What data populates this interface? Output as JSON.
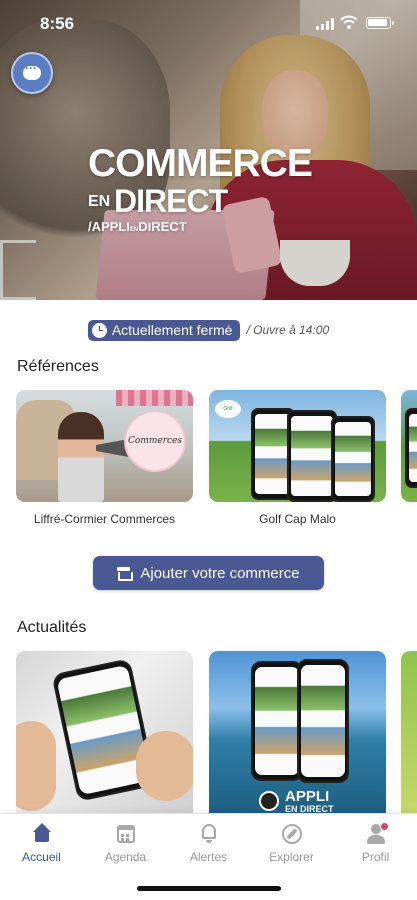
{
  "status_bar": {
    "time": "8:56"
  },
  "hero": {
    "logo_line1": "COMMERCE",
    "logo_en": "EN",
    "logo_direct": "DIRECT",
    "logo_tagline": "/APPLI",
    "logo_tagline_small": "EN",
    "logo_tagline_end": "DIRECT"
  },
  "opening": {
    "status_label": "Actuellement fermé",
    "opens_text": "/ Ouvre à 14:00"
  },
  "references": {
    "title": "Références",
    "items": [
      {
        "name": "Liffré-Cormier Commerces",
        "badge_text": "Commerces"
      },
      {
        "name": "Golf Cap Malo",
        "logo_text": "Golf"
      }
    ]
  },
  "add_button": {
    "label": "Ajouter votre commerce"
  },
  "news": {
    "title": "Actualités",
    "items": [
      {
        "brand_line1": "APPLI",
        "brand_line2": "EN DIRECT"
      }
    ]
  },
  "tabbar": {
    "items": [
      {
        "label": "Accueil",
        "icon": "home-icon",
        "active": true
      },
      {
        "label": "Agenda",
        "icon": "calendar-icon",
        "active": false
      },
      {
        "label": "Alertes",
        "icon": "bell-icon",
        "active": false
      },
      {
        "label": "Explorer",
        "icon": "compass-icon",
        "active": false
      },
      {
        "label": "Profil",
        "icon": "user-icon",
        "active": false
      }
    ]
  },
  "colors": {
    "accent": "#4a5894",
    "notification": "#e2455f"
  }
}
